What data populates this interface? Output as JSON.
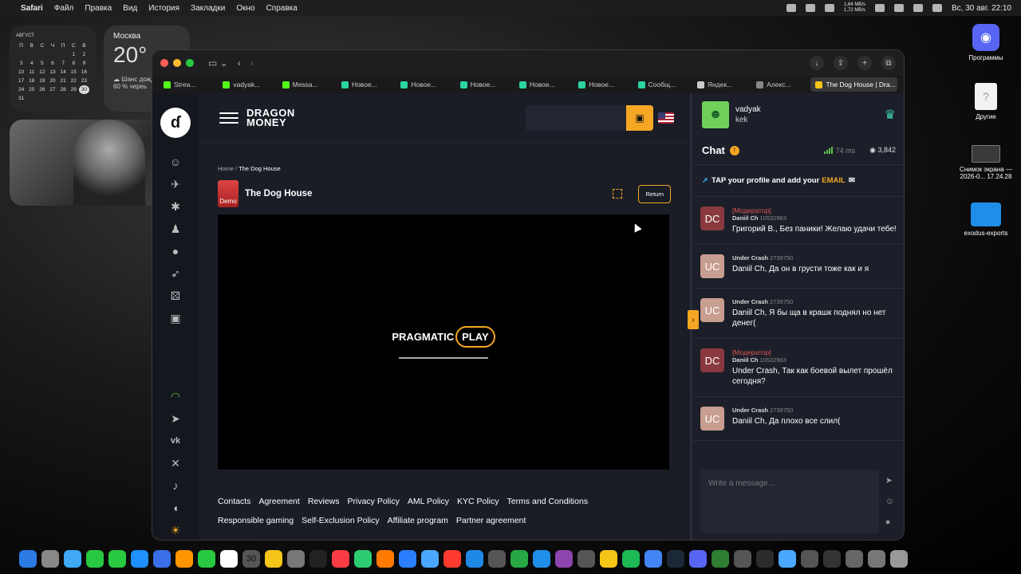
{
  "menubar": {
    "app": "Safari",
    "items": [
      "Файл",
      "Правка",
      "Вид",
      "История",
      "Закладки",
      "Окно",
      "Справка"
    ],
    "net_up": "1,64 MB/s",
    "net_down": "1,72 MB/s",
    "datetime": "Вс, 30 авг.  22:10"
  },
  "widgets": {
    "calendar": {
      "month": "АВГУСТ",
      "weekdays": [
        "П",
        "В",
        "С",
        "Ч",
        "П",
        "С",
        "В"
      ],
      "rows": [
        [
          "",
          "",
          "",
          "",
          "",
          "1",
          "2"
        ],
        [
          "3",
          "4",
          "5",
          "6",
          "7",
          "8",
          "9"
        ],
        [
          "10",
          "11",
          "12",
          "13",
          "14",
          "15",
          "16"
        ],
        [
          "17",
          "18",
          "19",
          "20",
          "21",
          "22",
          "23"
        ],
        [
          "24",
          "25",
          "26",
          "27",
          "28",
          "29",
          "30"
        ],
        [
          "31",
          "",
          "",
          "",
          "",
          "",
          ""
        ]
      ],
      "today": "30"
    },
    "weather": {
      "city": "Москва",
      "temp": "20°",
      "cond1": "Шанс дожд",
      "cond2": "60 % череь"
    }
  },
  "desktop": {
    "discord": "Программы",
    "other": "Другие",
    "screenshot1": "Снимок экрана —",
    "screenshot2": "2026-0... 17.24.28",
    "folder": "exodus-exports"
  },
  "browser": {
    "tabs": [
      {
        "label": "Strea...",
        "color": "#53fc18"
      },
      {
        "label": "vadyak...",
        "color": "#53fc18"
      },
      {
        "label": "Messa...",
        "color": "#53fc18"
      },
      {
        "label": "Новое...",
        "color": "#2bd4a0"
      },
      {
        "label": "Новое...",
        "color": "#2bd4a0"
      },
      {
        "label": "Новое...",
        "color": "#2bd4a0"
      },
      {
        "label": "Новое...",
        "color": "#2bd4a0"
      },
      {
        "label": "Новое...",
        "color": "#2bd4a0"
      },
      {
        "label": "Сообщ...",
        "color": "#2bd4a0"
      },
      {
        "label": "Яндек...",
        "color": "#cccccc"
      },
      {
        "label": "Алекс...",
        "color": "#888888"
      },
      {
        "label": "The Dog House | Dra...",
        "color": "#f5c518"
      }
    ]
  },
  "site": {
    "brand_line1": "DRAGON",
    "brand_line2": "MONEY",
    "breadcrumb_home": "Home",
    "breadcrumb_sep": "/",
    "breadcrumb_current": "The Dog House",
    "demo_label": "Demo",
    "game_title": "The Dog House",
    "return_label": "Return",
    "provider_a": "PRAGMATIC",
    "provider_b": "PLAY",
    "loading_fraction": 1.0,
    "footer_links": [
      "Contacts",
      "Agreement",
      "Reviews",
      "Privacy Policy",
      "AML Policy",
      "KYC Policy",
      "Terms and Conditions",
      "Responsible gaming",
      "Self-Exclusion Policy",
      "Affiliate program",
      "Partner agreement"
    ]
  },
  "chat": {
    "username": "vadyak",
    "usersub": "kek",
    "title": "Chat",
    "ping": "74 ms",
    "online": "3,842",
    "notice_pre": "TAP your profile and add your",
    "notice_em": "EMAIL",
    "input_placeholder": "Write a message...",
    "messages": [
      {
        "avatar": "DC",
        "kind": "dc",
        "role": "[Модератор]",
        "name": "Daniil Ch",
        "id": "10532963",
        "text": "Григорий В., Без паники! Желаю удачи тебе!"
      },
      {
        "avatar": "UC",
        "kind": "uc",
        "role": "",
        "name": "Under Crash",
        "id": "2739750",
        "text": "Daniil Ch, Да он в грусти тоже как и я"
      },
      {
        "avatar": "UC",
        "kind": "uc",
        "role": "",
        "name": "Under Crash",
        "id": "2739750",
        "text": "Daniil Ch, Я бы ща в крашк поднял но нет денег("
      },
      {
        "avatar": "DC",
        "kind": "dc",
        "role": "[Модератор]",
        "name": "Daniil Ch",
        "id": "10532963",
        "text": "Under Crash, Так как боевой вылет прошёл сегодня?"
      },
      {
        "avatar": "UC",
        "kind": "uc",
        "role": "",
        "name": "Under Crash",
        "id": "2739750",
        "text": "Daniil Ch, Да плохо все слил("
      }
    ]
  },
  "dock": {
    "calendar_day": "30",
    "colors": [
      "#2c7be5",
      "#888",
      "#3fa9f5",
      "#28c840",
      "#28c840",
      "#1e90ff",
      "#3a6ee8",
      "#ff9500",
      "#28c840",
      "#fff",
      "#555",
      "#f5c518",
      "#777",
      "#222",
      "#fc3c44",
      "#2ecc71",
      "#ff7a00",
      "#2b7fff",
      "#4aa8ff",
      "#ff3b30",
      "#1e88e5",
      "#555",
      "#28a745",
      "#1f8ee8",
      "#8e44ad",
      "#555",
      "#f5c518",
      "#1db954",
      "#4285f4",
      "#1b2838",
      "#5865f2",
      "#2e7d32",
      "#555",
      "#2c2c2c",
      "#4aa8ff",
      "#555",
      "#333",
      "#666",
      "#777",
      "#999"
    ]
  }
}
